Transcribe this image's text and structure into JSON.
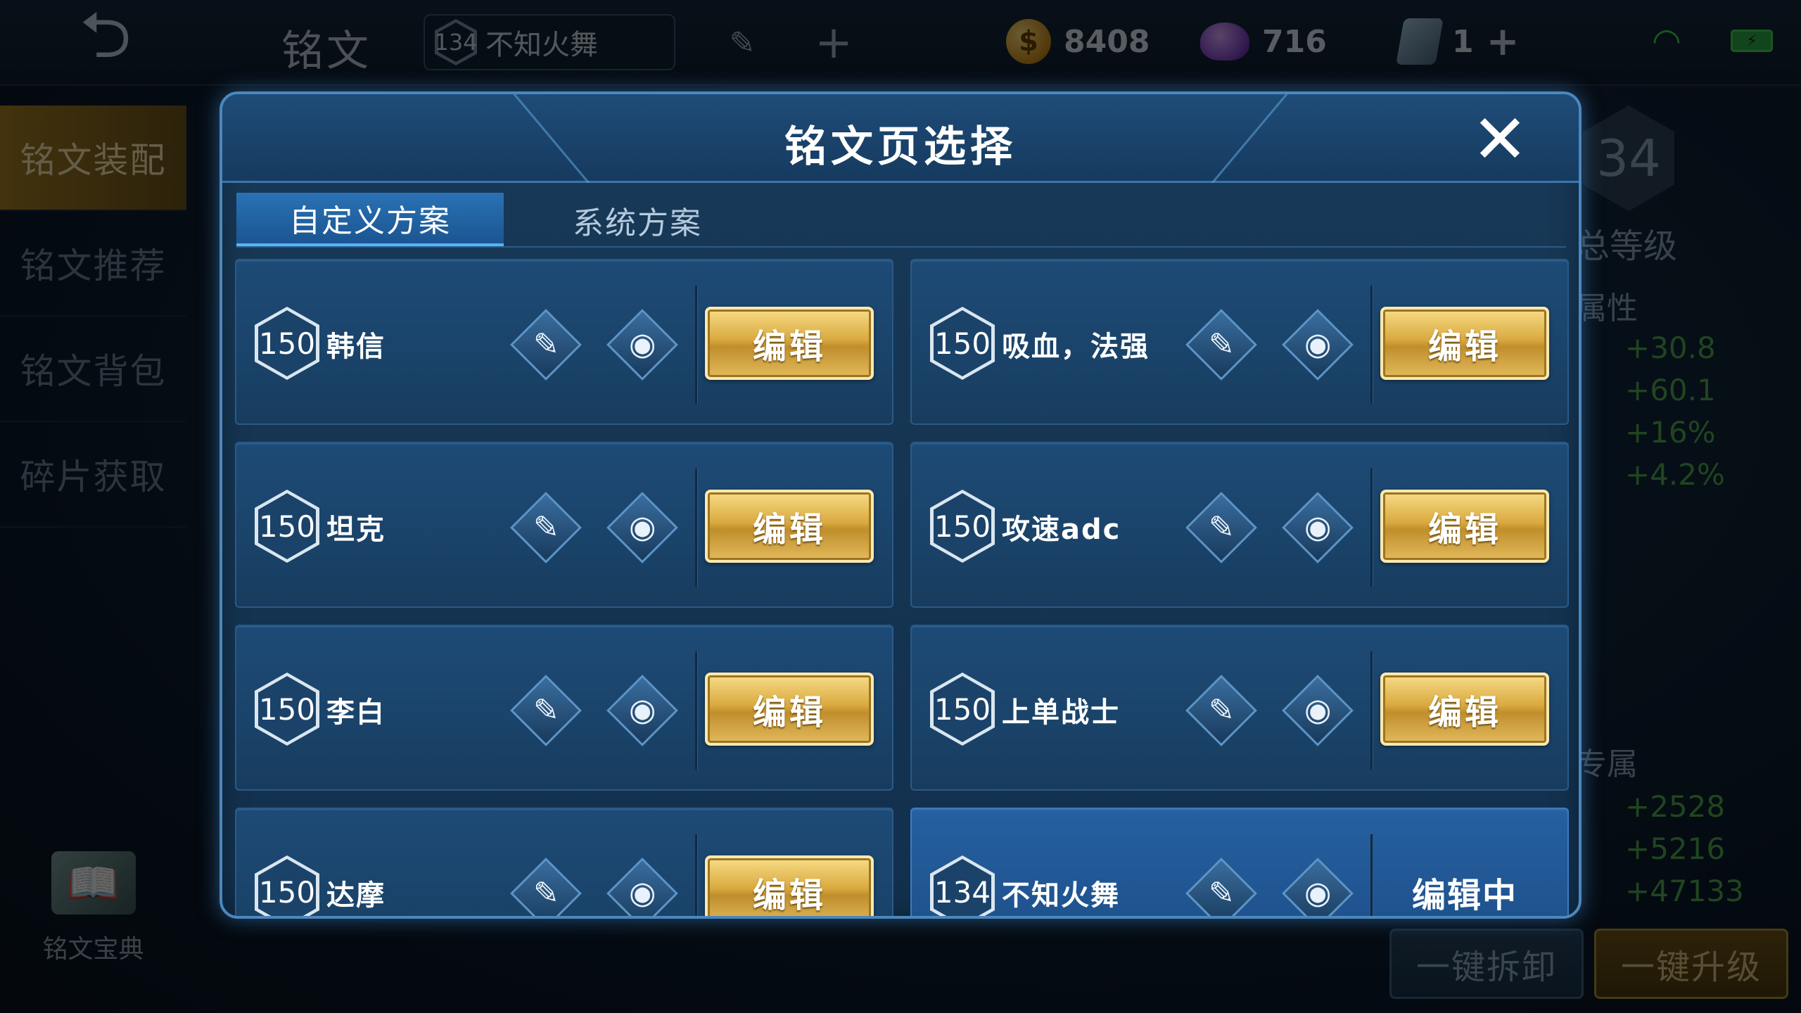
{
  "topbar": {
    "title": "铭文",
    "current_page": {
      "level": "134",
      "name": "不知火舞"
    },
    "gold": "8408",
    "gems": "716",
    "tickets": "1"
  },
  "sidenav": {
    "items": [
      "铭文装配",
      "铭文推荐",
      "铭文背包",
      "碎片获取"
    ],
    "active_index": 0,
    "book_label": "铭文宝典"
  },
  "right_panel": {
    "level": "34",
    "total_level": "总等级",
    "attr_title": "属性",
    "attrs": [
      "+30.8",
      "+60.1",
      "+16%",
      "+4.2%"
    ],
    "exclusive_title": "专属",
    "exclusive": [
      "+2528",
      "+5216",
      "+47133"
    ]
  },
  "bottom": {
    "dismantle": "一键拆卸",
    "upgrade": "一键升级"
  },
  "modal": {
    "title": "铭文页选择",
    "tabs": [
      "自定义方案",
      "系统方案"
    ],
    "edit_label": "编辑",
    "editing_label": "编辑中",
    "pages": [
      {
        "level": "150",
        "name": "韩信"
      },
      {
        "level": "150",
        "name": "吸血，法强"
      },
      {
        "level": "150",
        "name": "坦克"
      },
      {
        "level": "150",
        "name": "攻速adc"
      },
      {
        "level": "150",
        "name": "李白"
      },
      {
        "level": "150",
        "name": "上单战士"
      },
      {
        "level": "150",
        "name": "达摩"
      },
      {
        "level": "134",
        "name": "不知火舞",
        "editing": true
      }
    ]
  },
  "colors": {
    "modal_border": "#4c87bd",
    "edit_gold": "#d9a93f",
    "attr_green": "#4ea84e"
  }
}
